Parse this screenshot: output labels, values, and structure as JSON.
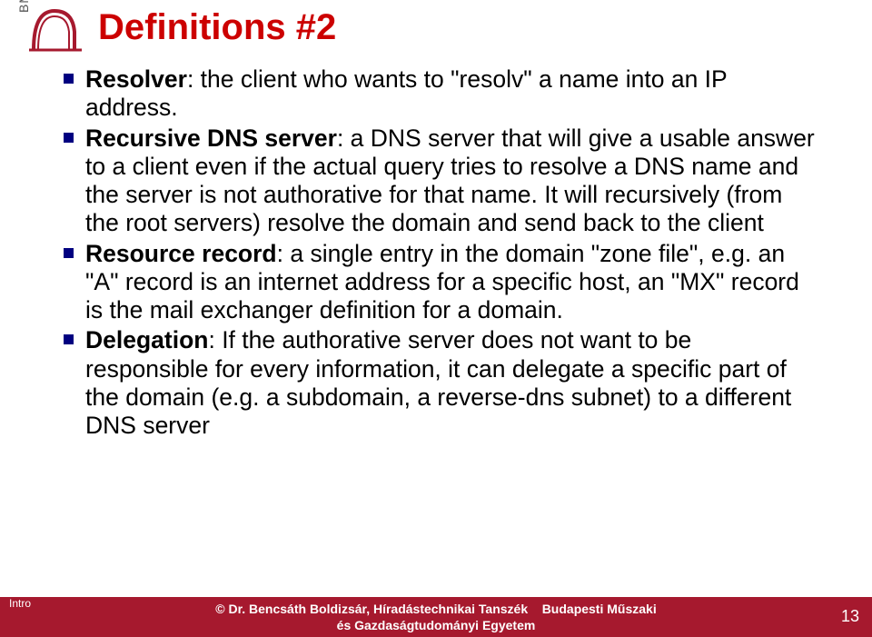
{
  "sidebar": {
    "bme": "BME"
  },
  "title": "Definitions #2",
  "bullets": [
    {
      "term": "Resolver",
      "rest": ": the client who wants to \"resolv\" a name into an IP address."
    },
    {
      "term": "Recursive DNS server",
      "rest": ": a DNS server that will give a usable  answer to a client even if the actual query tries to resolve a DNS name and the server is not authorative for that name. It will recursively (from the root servers) resolve the domain and send back to the client"
    },
    {
      "term": "Resource record",
      "rest": ": a single entry in the domain \"zone file\", e.g. an \"A\" record is an internet address for a specific host, an \"MX\" record is the mail exchanger definition for a domain."
    },
    {
      "term": "Delegation",
      "rest": ": If the authorative server does not want to be responsible for every information, it can delegate a specific part of the domain (e.g. a subdomain, a reverse-dns subnet) to a different DNS server"
    }
  ],
  "footer": {
    "intro": "Intro",
    "copyright": "©  Dr. Bencsáth Boldizsár, Híradástechnikai Tanszék",
    "uni_part1": "Budapesti Műszaki",
    "uni_line2": "és Gazdaságtudományi Egyetem",
    "page": "13"
  }
}
